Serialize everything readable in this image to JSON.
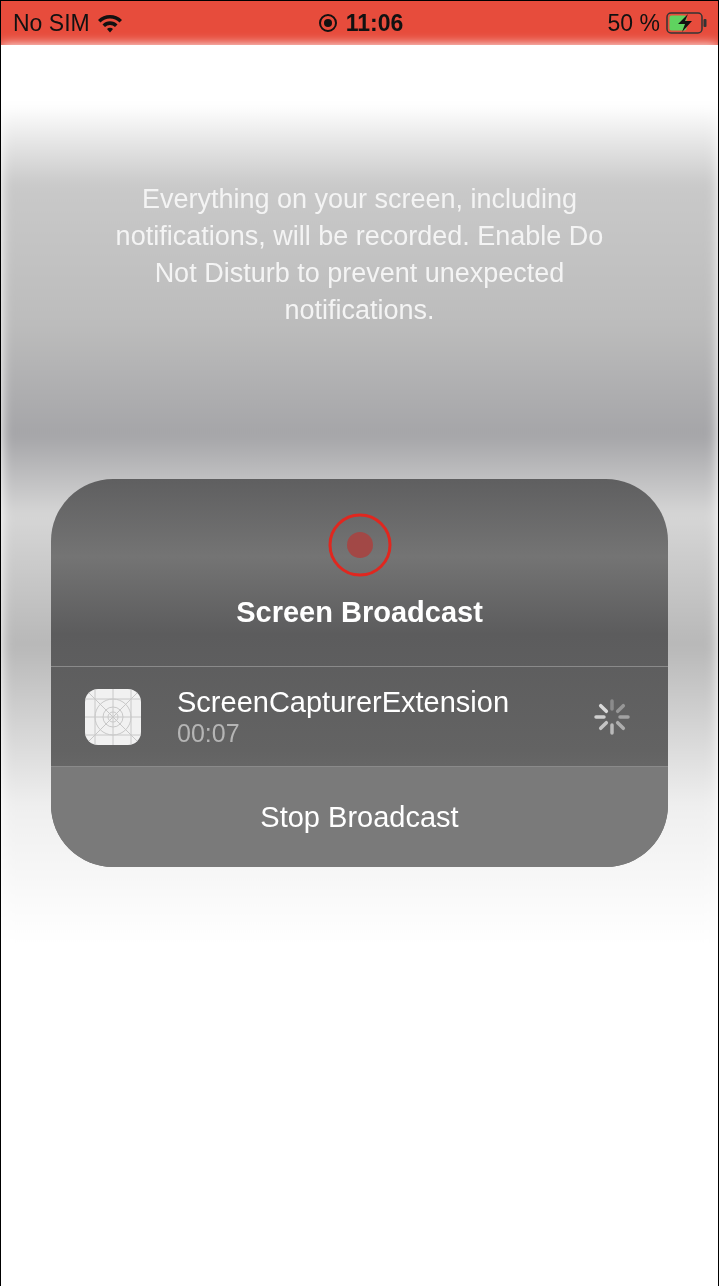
{
  "status_bar": {
    "carrier": "No SIM",
    "time": "11:06",
    "battery": "50 %"
  },
  "warning": "Everything on your screen, including notifications, will be recorded. Enable Do Not Disturb to prevent unexpected notifications.",
  "sheet": {
    "title": "Screen Broadcast",
    "extension": {
      "name": "ScreenCapturerExtension",
      "elapsed": "00:07"
    },
    "button": "Stop Broadcast"
  }
}
